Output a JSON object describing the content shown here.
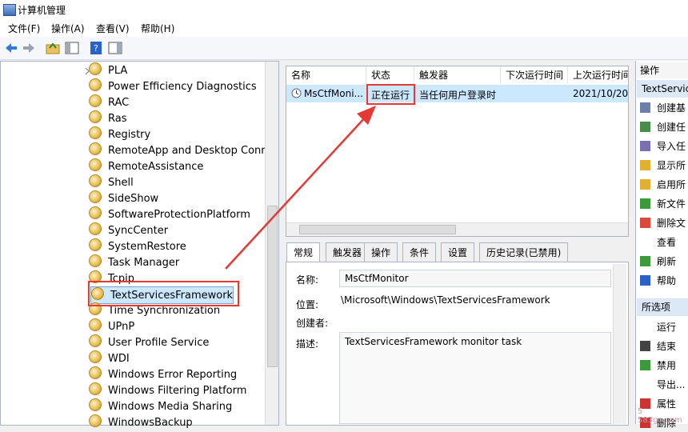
{
  "window": {
    "title": "计算机管理"
  },
  "menu": [
    "文件(F)",
    "操作(A)",
    "查看(V)",
    "帮助(H)"
  ],
  "tree": {
    "items": [
      "PLA",
      "Power Efficiency Diagnostics",
      "RAC",
      "Ras",
      "Registry",
      "RemoteApp and Desktop Conne",
      "RemoteAssistance",
      "Shell",
      "SideShow",
      "SoftwareProtectionPlatform",
      "SyncCenter",
      "SystemRestore",
      "Task Manager",
      "Tcpip",
      "TextServicesFramework",
      "Time Synchronization",
      "UPnP",
      "User Profile Service",
      "WDI",
      "Windows Error Reporting",
      "Windows Filtering Platform",
      "Windows Media Sharing",
      "WindowsBackup"
    ],
    "selected": "TextServicesFramework"
  },
  "task_list": {
    "columns": [
      "名称",
      "状态",
      "触发器",
      "下次运行时间",
      "上次运行时间"
    ],
    "row": {
      "name": "MsCtfMoni...",
      "status": "正在运行",
      "trigger": "当任何用户登录时",
      "next": "",
      "last": "2021/10/20"
    }
  },
  "tabs": [
    "常规",
    "触发器",
    "操作",
    "条件",
    "设置",
    "历史记录(已禁用)"
  ],
  "general": {
    "name_label": "名称:",
    "name_value": "MsCtfMonitor",
    "location_label": "位置:",
    "location_value": "\\Microsoft\\Windows\\TextServicesFramework",
    "author_label": "创建者:",
    "author_value": "",
    "desc_label": "描述:",
    "desc_value": "TextServicesFramework monitor task"
  },
  "actions": {
    "header": "操作",
    "group1_title": "TextServic",
    "group1": [
      "创建基",
      "创建任",
      "导入任",
      "显示所",
      "启用所",
      "新文件",
      "删除文",
      "查看",
      "刷新",
      "帮助"
    ],
    "group2_title": "所选项",
    "group2": [
      "运行",
      "结束",
      "禁用",
      "导出...",
      "属性",
      "删除"
    ]
  },
  "watermark": "5 583go.com",
  "colors": {
    "highlight_red": "#e53935",
    "selection_blue": "#cce8ff",
    "section_blue": "#dde8f7"
  }
}
